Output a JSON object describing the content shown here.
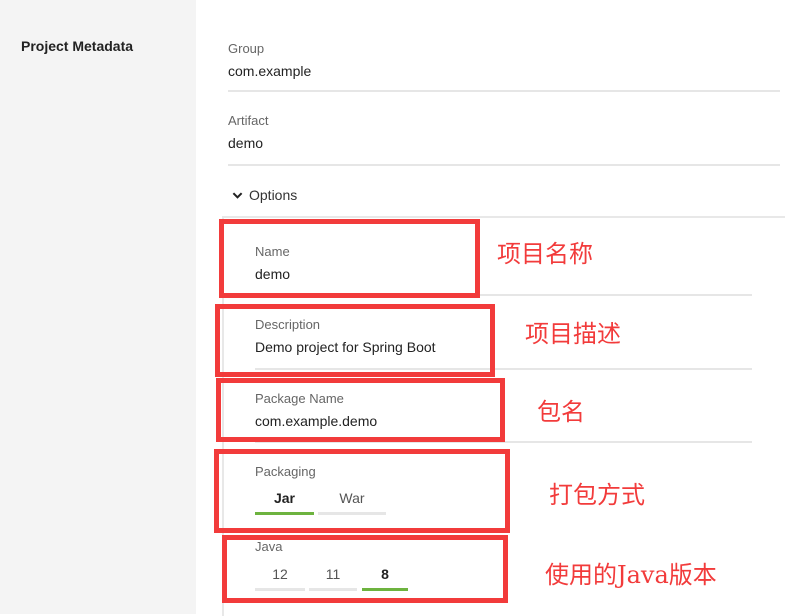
{
  "section": {
    "title": "Project Metadata"
  },
  "fields": {
    "group": {
      "label": "Group",
      "value": "com.example"
    },
    "artifact": {
      "label": "Artifact",
      "value": "demo"
    },
    "name": {
      "label": "Name",
      "value": "demo"
    },
    "description": {
      "label": "Description",
      "value": "Demo project for Spring Boot"
    },
    "package_name": {
      "label": "Package Name",
      "value": "com.example.demo"
    }
  },
  "options": {
    "label": "Options"
  },
  "packaging": {
    "label": "Packaging",
    "options": [
      "Jar",
      "War"
    ],
    "selected": "Jar"
  },
  "java": {
    "label": "Java",
    "options": [
      "12",
      "11",
      "8"
    ],
    "selected": "8"
  },
  "annotations": {
    "name": "项目名称",
    "description": "项目描述",
    "package": "包名",
    "packaging": "打包方式",
    "java": "使用的Java版本"
  },
  "colors": {
    "accent": "#6db33f",
    "annotation": "#f23b3b",
    "sidebar_bg": "#f4f4f4"
  }
}
